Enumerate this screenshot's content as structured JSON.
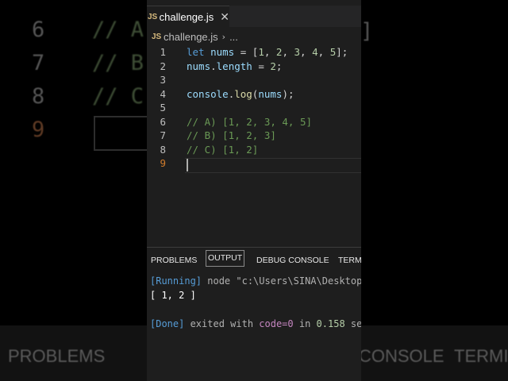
{
  "background": {
    "line_numbers": [
      "6",
      "7",
      "8",
      "9"
    ],
    "code_fragments": [
      "// A",
      "// B",
      "// C"
    ],
    "bracket": "]",
    "bottom_tabs": [
      "PROBLEMS",
      "CONSOLE",
      "TERMI"
    ]
  },
  "tab": {
    "badge": "JS",
    "filename": "challenge.js",
    "close_glyph": "✕"
  },
  "breadcrumb": {
    "badge": "JS",
    "file": "challenge.js",
    "separator": "›",
    "more": "..."
  },
  "editor": {
    "active_line": 9,
    "lines": [
      {
        "n": "1",
        "tokens": [
          [
            "kw",
            "let "
          ],
          [
            "var",
            "nums"
          ],
          [
            "pl",
            " = ["
          ],
          [
            "num",
            "1"
          ],
          [
            "pl",
            ", "
          ],
          [
            "num",
            "2"
          ],
          [
            "pl",
            ", "
          ],
          [
            "num",
            "3"
          ],
          [
            "pl",
            ", "
          ],
          [
            "num",
            "4"
          ],
          [
            "pl",
            ", "
          ],
          [
            "num",
            "5"
          ],
          [
            "pl",
            "];"
          ]
        ]
      },
      {
        "n": "2",
        "tokens": [
          [
            "var",
            "nums"
          ],
          [
            "pl",
            "."
          ],
          [
            "var",
            "length"
          ],
          [
            "pl",
            " = "
          ],
          [
            "num",
            "2"
          ],
          [
            "pl",
            ";"
          ]
        ]
      },
      {
        "n": "3",
        "tokens": []
      },
      {
        "n": "4",
        "tokens": [
          [
            "var",
            "console"
          ],
          [
            "pl",
            "."
          ],
          [
            "fn",
            "log"
          ],
          [
            "pl",
            "("
          ],
          [
            "var",
            "nums"
          ],
          [
            "pl",
            ");"
          ]
        ]
      },
      {
        "n": "5",
        "tokens": []
      },
      {
        "n": "6",
        "tokens": [
          [
            "cm",
            "// A) [1, 2, 3, 4, 5]"
          ]
        ]
      },
      {
        "n": "7",
        "tokens": [
          [
            "cm",
            "// B) [1, 2, 3]"
          ]
        ]
      },
      {
        "n": "8",
        "tokens": [
          [
            "cm",
            "// C) [1, 2]"
          ]
        ]
      },
      {
        "n": "9",
        "tokens": []
      }
    ]
  },
  "panel": {
    "tabs": [
      "PROBLEMS",
      "OUTPUT",
      "DEBUG CONSOLE",
      "TERMI"
    ],
    "active_tab": "OUTPUT",
    "output": {
      "running_tag": "[Running]",
      "running_cmd": " node \"c:\\Users\\SINA\\Desktop",
      "result": "[ 1, 2 ]",
      "done_tag": "[Done]",
      "done_text1": " exited with ",
      "done_code": "code=0",
      "done_text2": " in ",
      "done_time": "0.158",
      "done_text3": " se"
    }
  },
  "colors": {
    "editor_bg": "#1e1e1e",
    "keyword": "#569cd6",
    "variable": "#9cdcfe",
    "number": "#b5cea8",
    "function": "#dcdcaa",
    "comment": "#6a9955",
    "active_line_number": "#d17c2b"
  }
}
